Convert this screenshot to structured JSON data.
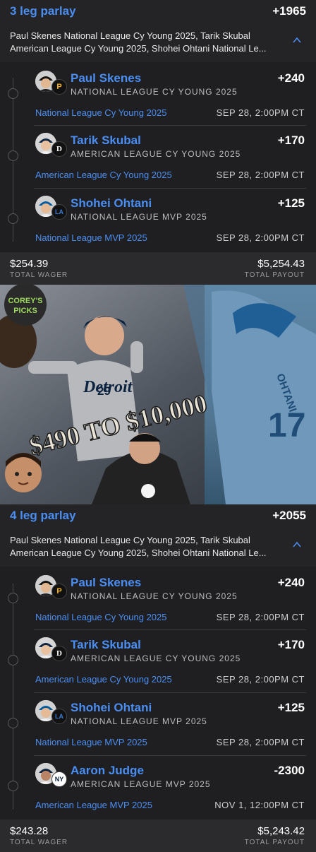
{
  "parlay1": {
    "title": "3 leg parlay",
    "odds": "+1965",
    "desc_line1": "Paul Skenes National League Cy Young 2025, Tarik Skubal",
    "desc_line2": "American League Cy Young 2025, Shohei Ohtani National Le...",
    "legs": [
      {
        "name": "Paul Skenes",
        "sub": "NATIONAL LEAGUE CY YOUNG 2025",
        "odds": "+240",
        "market": "National League Cy Young 2025",
        "date": "SEP 28, 2:00PM CT",
        "team": "P"
      },
      {
        "name": "Tarik Skubal",
        "sub": "AMERICAN LEAGUE CY YOUNG 2025",
        "odds": "+170",
        "market": "American League Cy Young 2025",
        "date": "SEP 28, 2:00PM CT",
        "team": "D"
      },
      {
        "name": "Shohei Ohtani",
        "sub": "NATIONAL LEAGUE MVP 2025",
        "odds": "+125",
        "market": "National League MVP 2025",
        "date": "SEP 28, 2:00PM CT",
        "team": "LA"
      }
    ],
    "wager": "$254.39",
    "wager_label": "TOTAL WAGER",
    "payout": "$5,254.43",
    "payout_label": "TOTAL PAYOUT"
  },
  "promo": {
    "logo_line1": "COREY'S",
    "logo_line2": "PICKS",
    "headline": "$490 TO $10,000",
    "jersey_detroit": "Detroit",
    "jersey_29": "29",
    "jersey_ohtani": "OHTANI",
    "jersey_17": "17"
  },
  "parlay2": {
    "title": "4 leg parlay",
    "odds": "+2055",
    "desc_line1": "Paul Skenes National League Cy Young 2025, Tarik Skubal",
    "desc_line2": "American League Cy Young 2025, Shohei Ohtani National Le...",
    "legs": [
      {
        "name": "Paul Skenes",
        "sub": "NATIONAL LEAGUE CY YOUNG 2025",
        "odds": "+240",
        "market": "National League Cy Young 2025",
        "date": "SEP 28, 2:00PM CT",
        "team": "P"
      },
      {
        "name": "Tarik Skubal",
        "sub": "AMERICAN LEAGUE CY YOUNG 2025",
        "odds": "+170",
        "market": "American League Cy Young 2025",
        "date": "SEP 28, 2:00PM CT",
        "team": "D"
      },
      {
        "name": "Shohei Ohtani",
        "sub": "NATIONAL LEAGUE MVP 2025",
        "odds": "+125",
        "market": "National League MVP 2025",
        "date": "SEP 28, 2:00PM CT",
        "team": "LA"
      },
      {
        "name": "Aaron Judge",
        "sub": "AMERICAN LEAGUE MVP 2025",
        "odds": "-2300",
        "market": "American League MVP 2025",
        "date": "NOV 1, 12:00PM CT",
        "team": "NY"
      }
    ],
    "wager": "$243.28",
    "wager_label": "TOTAL WAGER",
    "payout": "$5,243.42",
    "payout_label": "TOTAL PAYOUT"
  },
  "colors": {
    "accent": "#4b8ef3",
    "background": "#1c1c1e"
  }
}
